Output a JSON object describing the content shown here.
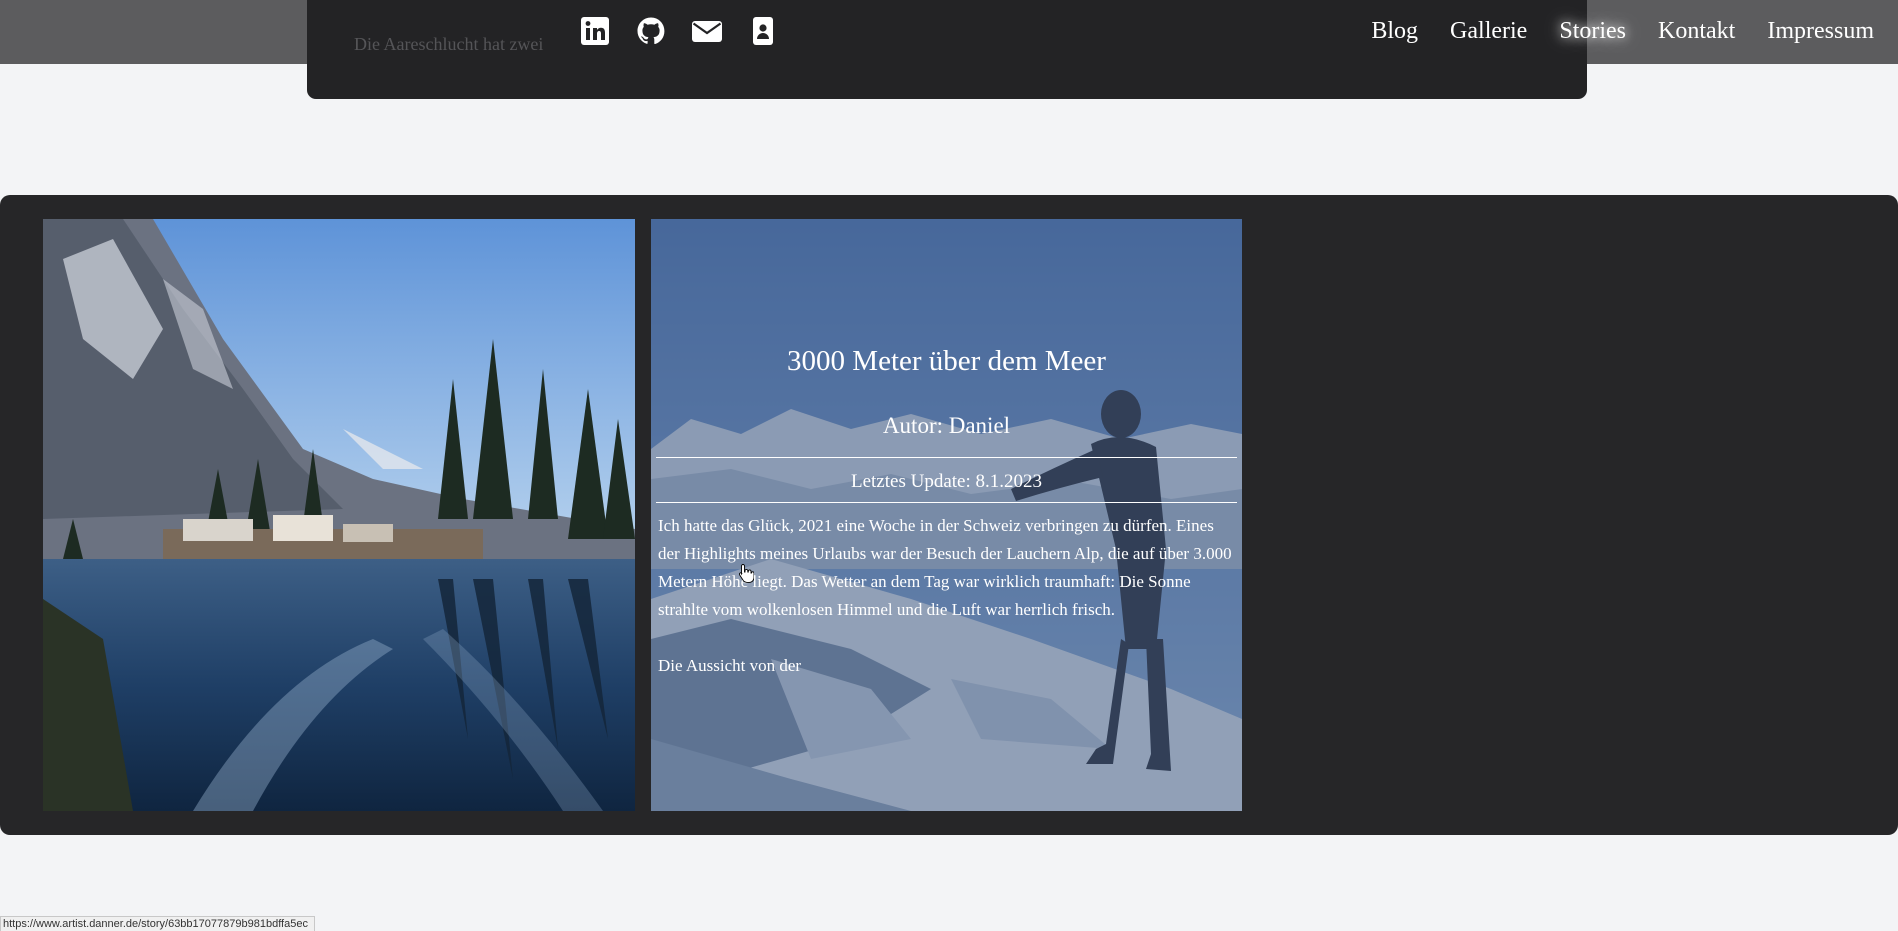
{
  "header": {
    "teaser_text": "Die Aareschlucht hat zwei",
    "social_icons": [
      "linkedin-icon",
      "github-icon",
      "mail-icon",
      "contact-card-icon"
    ],
    "nav": [
      {
        "label": "Blog",
        "active": false
      },
      {
        "label": "Gallerie",
        "active": false
      },
      {
        "label": "Stories",
        "active": true
      },
      {
        "label": "Kontakt",
        "active": false
      },
      {
        "label": "Impressum",
        "active": false
      }
    ]
  },
  "story": {
    "title": "3000 Meter über dem Meer",
    "author": "Autor: Daniel",
    "updated": "Letztes Update: 8.1.2023",
    "paragraph_1": "Ich hatte das Glück, 2021 eine Woche in der Schweiz verbringen zu dürfen. Eines der Highlights meines Urlaubs war der Besuch der Lauchern Alp, die auf über 3.000 Metern Höhe liegt. Das Wetter an dem Tag war wirklich traumhaft: Die Sonne strahlte vom wolkenlosen Himmel und die Luft war herrlich frisch.",
    "paragraph_2": "Die Aussicht von der"
  },
  "status_bar": {
    "url": "https://www.artist.danner.de/story/63bb17077879b981bdffa5ec"
  },
  "colors": {
    "page_bg": "#f3f4f6",
    "header_bg": "#232325",
    "topbar_bg": "#5c5c5e",
    "section_bg": "#262628",
    "card_overlay": "#465c84"
  }
}
